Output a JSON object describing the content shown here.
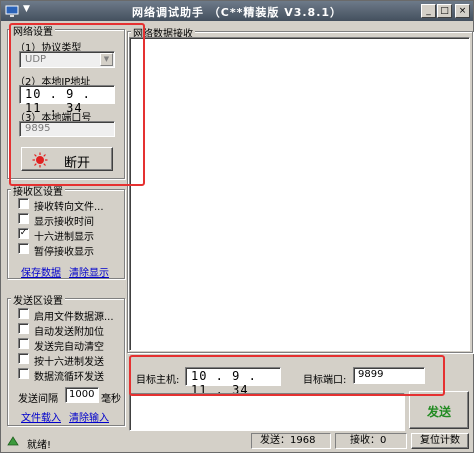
{
  "window": {
    "title": "网络调试助手 （C**精装版 V3.8.1）"
  },
  "titlebar": {
    "menu_caret": "▼",
    "min": "_",
    "max": "□",
    "close": "×"
  },
  "network": {
    "group_title": "网络设置",
    "protocol_label": "（1）协议类型",
    "protocol_value": "UDP",
    "ip_label": "（2）本地IP地址",
    "ip_value": "10 . 9 . 11 . 34",
    "port_label": "（3）本地端口号",
    "port_value": "9895",
    "connect_button": "断开"
  },
  "receive_settings": {
    "group_title": "接收区设置",
    "options": [
      {
        "label": "接收转向文件...",
        "checked": false
      },
      {
        "label": "显示接收时间",
        "checked": false
      },
      {
        "label": "十六进制显示",
        "checked": true
      },
      {
        "label": "暂停接收显示",
        "checked": false
      }
    ],
    "save_link": "保存数据",
    "clear_link": "清除显示"
  },
  "send_settings": {
    "group_title": "发送区设置",
    "options": [
      {
        "label": "启用文件数据源...",
        "checked": false
      },
      {
        "label": "自动发送附加位",
        "checked": false
      },
      {
        "label": "发送完自动清空",
        "checked": false
      },
      {
        "label": "按十六进制发送",
        "checked": false
      },
      {
        "label": "数据流循环发送",
        "checked": false
      }
    ],
    "interval_label": "发送间隔",
    "interval_value": "1000",
    "interval_unit": "毫秒",
    "load_link": "文件载入",
    "clear_input_link": "清除输入"
  },
  "receive_area": {
    "title": "网络数据接收",
    "content": ""
  },
  "target": {
    "host_label": "目标主机:",
    "host_value": "10 . 9 . 11 . 34",
    "port_label": "目标端口:",
    "port_value": "9899"
  },
  "send_button": "发送",
  "status": {
    "text": "就绪!",
    "sent": "发送：1968",
    "received": "接收：0",
    "reset": "复位计数"
  },
  "colors": {
    "highlight": "#e53131",
    "send_text": "#228b22",
    "link": "#0000cc"
  }
}
